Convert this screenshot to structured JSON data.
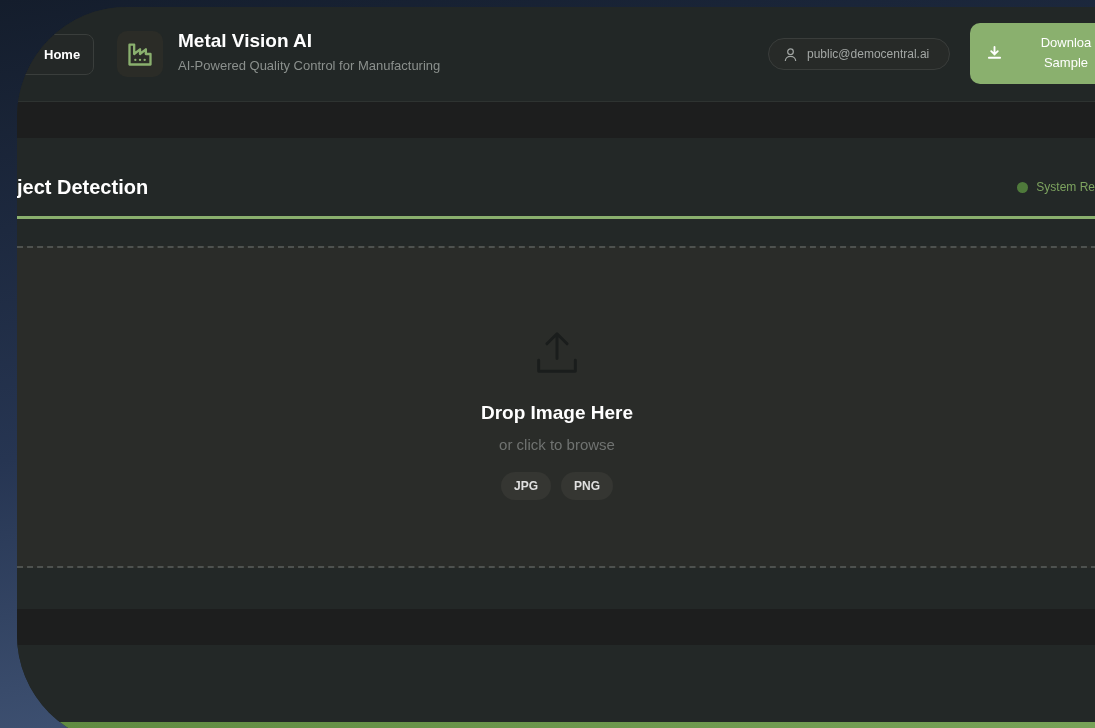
{
  "header": {
    "home_button": {
      "label": "Home"
    },
    "app_title": "Metal Vision AI",
    "app_subtitle": "AI-Powered Quality Control for Manufacturing",
    "user_email": "public@democentral.ai",
    "download_button": {
      "lines": [
        "Downloa",
        "Sample"
      ]
    }
  },
  "detection_panel": {
    "title": "ject Detection",
    "status": "System Re"
  },
  "dropzone": {
    "heading": "Drop Image Here",
    "hint": "or click to browse",
    "formats": [
      "JPG",
      "PNG"
    ]
  }
}
